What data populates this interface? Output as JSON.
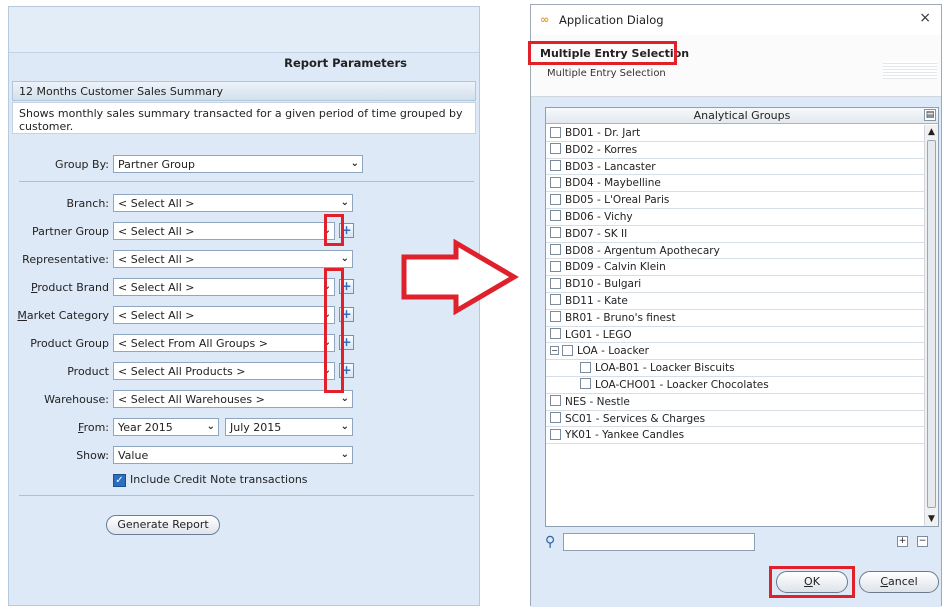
{
  "left": {
    "panel_title": "Report Parameters",
    "report_name": "12 Months Customer Sales Summary",
    "description": "Shows monthly sales summary transacted for a given period of time grouped by customer.",
    "group_by": {
      "label": "Group By:",
      "value": "Partner Group"
    },
    "branch": {
      "label": "Branch:",
      "value": "< Select All >"
    },
    "partner_group": {
      "label": "Partner Group",
      "value": "< Select All >"
    },
    "representative": {
      "label": "Representative:",
      "value": "< Select All >"
    },
    "product_brand": {
      "label_u": "P",
      "label_rest": "roduct Brand",
      "value": "< Select All >"
    },
    "market_category": {
      "label_u": "M",
      "label_rest": "arket Category",
      "value": "< Select All >"
    },
    "product_group": {
      "label": "Product Group",
      "value": "< Select From All Groups >"
    },
    "product": {
      "label": "Product",
      "value": "< Select All Products >"
    },
    "warehouse": {
      "label": "Warehouse:",
      "value": "< Select All Warehouses >"
    },
    "from": {
      "label_u": "F",
      "label_rest": "rom:",
      "year": "Year 2015",
      "month": "July 2015"
    },
    "show": {
      "label": "Show:",
      "value": "Value"
    },
    "include_credit_note": {
      "label": "Include Credit Note transactions",
      "checked": true
    },
    "generate_button": "Generate Report"
  },
  "dialog": {
    "window_title": "Application Dialog",
    "close_glyph": "×",
    "header_title": "Multiple Entry Selection",
    "header_subtitle": "Multiple Entry Selection",
    "column_header": "Analytical Groups",
    "items": [
      "BD01 - Dr. Jart",
      "BD02 - Korres",
      "BD03 - Lancaster",
      "BD04 - Maybelline",
      "BD05 - L'Oreal Paris",
      "BD06 - Vichy",
      "BD07 - SK II",
      "BD08 - Argentum Apothecary",
      "BD09 - Calvin Klein",
      "BD10 - Bulgari",
      "BD11 - Kate",
      "BR01 - Bruno's finest",
      "LG01 - LEGO"
    ],
    "group_item": "LOA - Loacker",
    "children": [
      "LOA-B01 - Loacker Biscuits",
      "LOA-CHO01 - Loacker Chocolates"
    ],
    "items_after": [
      "NES - Nestle",
      "SC01 - Services & Charges",
      "YK01 - Yankee Candles"
    ],
    "ok_u": "O",
    "ok_rest": "K",
    "cancel_u": "C",
    "cancel_rest": "ancel"
  },
  "accent_red": "#e0202a"
}
